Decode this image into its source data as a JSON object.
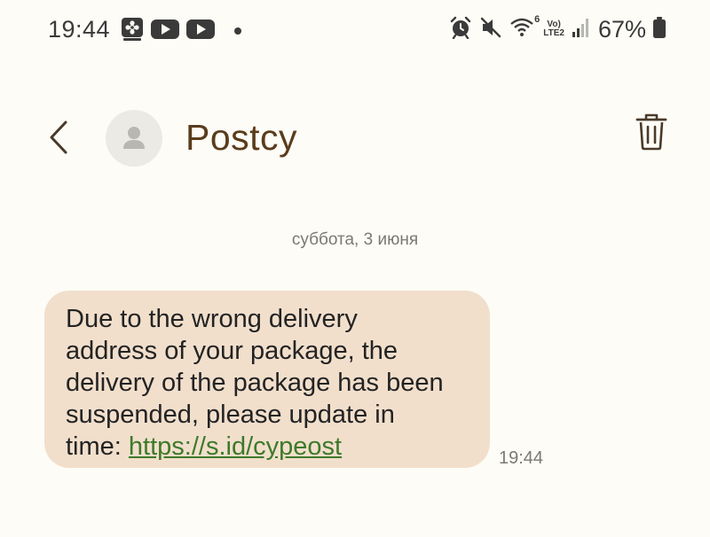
{
  "status_bar": {
    "time": "19:44",
    "battery_percent": "67%",
    "signal_label": "LTE2",
    "volte_label": "Vo)",
    "wifi_label": "6",
    "icons": [
      "gallery-flower-icon",
      "youtube-icon",
      "youtube-icon",
      "notification-dot",
      "alarm-icon",
      "mute-icon",
      "wifi-icon",
      "volte-lte-icon",
      "signal-icon",
      "battery-icon"
    ]
  },
  "header": {
    "contact_name": "Postcy",
    "back_icon": "chevron-left-icon",
    "delete_icon": "trash-icon"
  },
  "conversation": {
    "date_separator": "суббота, 3 июня",
    "messages": [
      {
        "text_lines": [
          "Due to the wrong delivery",
          "address of your package, the",
          "delivery of the package has been",
          "suspended, please update in",
          "time: "
        ],
        "link": "https://s.id/cypeost",
        "time": "19:44"
      }
    ]
  },
  "colors": {
    "background": "#fdfcf6",
    "bubble": "#f1dfcc",
    "name": "#5a3c1c",
    "link": "#3e7a2a"
  }
}
